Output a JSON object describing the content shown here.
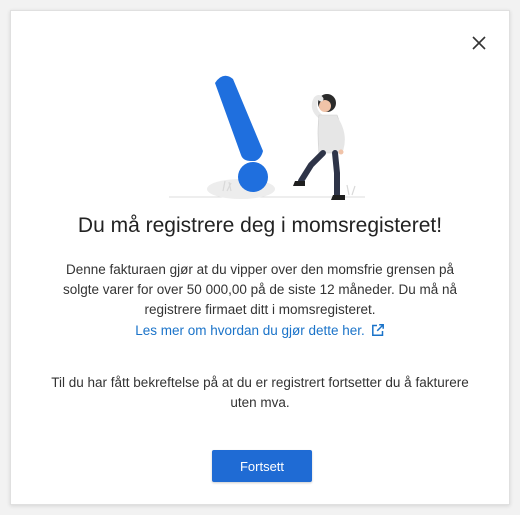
{
  "dialog": {
    "close_icon": "close-icon",
    "title": "Du må registrere deg i momsregisteret!",
    "body": "Denne fakturaen gjør at du vipper over den momsfrie grensen på solgte varer for over 50 000,00 på de siste 12 måneder. Du må nå registrere firmaet ditt i momsregisteret.",
    "link_text": "Les mer om hvordan du gjør dette her.",
    "link_icon": "external-link-icon",
    "body_2": "Til du har fått bekreftelse på at du er registrert fortsetter du å fakturere uten mva.",
    "button_label": "Fortsett"
  },
  "colors": {
    "accent": "#1f6bd4",
    "link": "#1a73c9",
    "illustration_blue": "#1f6fde"
  }
}
